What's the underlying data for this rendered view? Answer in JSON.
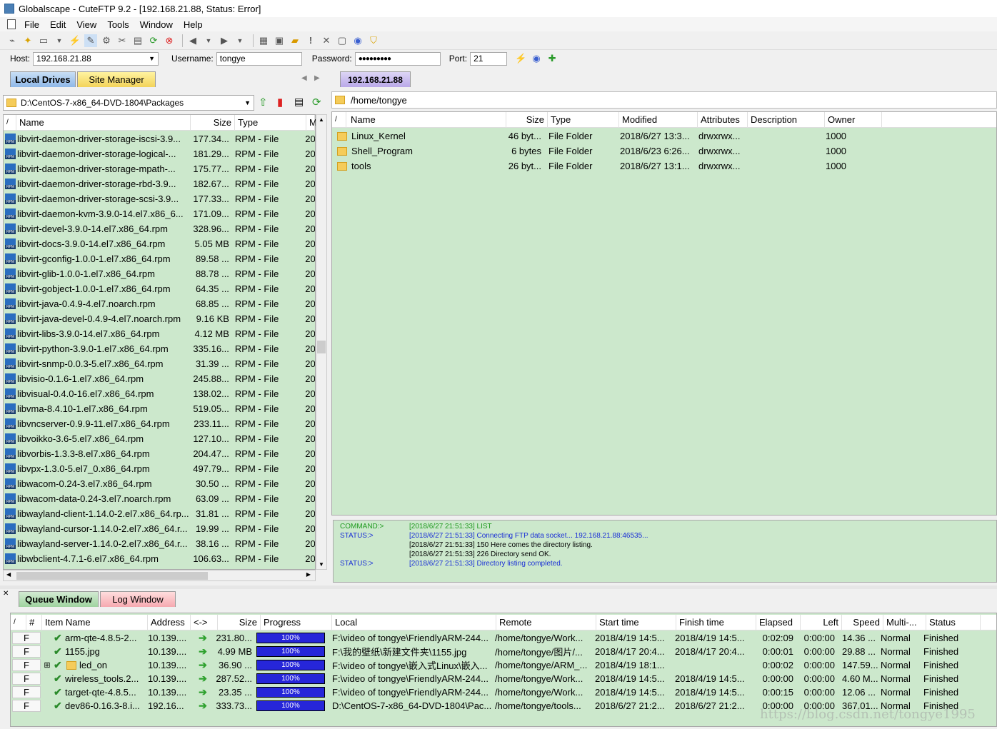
{
  "window": {
    "title": "Globalscape - CuteFTP 9.2 - [192.168.21.88, Status: Error]"
  },
  "menu": [
    "File",
    "Edit",
    "View",
    "Tools",
    "Window",
    "Help"
  ],
  "connection": {
    "host_label": "Host:",
    "host_value": "192.168.21.88",
    "username_label": "Username:",
    "username_value": "tongye",
    "password_label": "Password:",
    "password_value": "●●●●●●●●●",
    "port_label": "Port:",
    "port_value": "21"
  },
  "left_tabs": {
    "local": "Local Drives",
    "site": "Site Manager"
  },
  "left_path": "D:\\CentOS-7-x86_64-DVD-1804\\Packages",
  "left_columns": [
    "/",
    "Name",
    "Size",
    "Type",
    "M"
  ],
  "left_files": [
    {
      "name": "libvirt-daemon-driver-storage-iscsi-3.9...",
      "size": "177.34...",
      "type": "RPM - File",
      "m": "20"
    },
    {
      "name": "libvirt-daemon-driver-storage-logical-...",
      "size": "181.29...",
      "type": "RPM - File",
      "m": "20"
    },
    {
      "name": "libvirt-daemon-driver-storage-mpath-...",
      "size": "175.77...",
      "type": "RPM - File",
      "m": "20"
    },
    {
      "name": "libvirt-daemon-driver-storage-rbd-3.9...",
      "size": "182.67...",
      "type": "RPM - File",
      "m": "20"
    },
    {
      "name": "libvirt-daemon-driver-storage-scsi-3.9...",
      "size": "177.33...",
      "type": "RPM - File",
      "m": "20"
    },
    {
      "name": "libvirt-daemon-kvm-3.9.0-14.el7.x86_6...",
      "size": "171.09...",
      "type": "RPM - File",
      "m": "20"
    },
    {
      "name": "libvirt-devel-3.9.0-14.el7.x86_64.rpm",
      "size": "328.96...",
      "type": "RPM - File",
      "m": "20"
    },
    {
      "name": "libvirt-docs-3.9.0-14.el7.x86_64.rpm",
      "size": "5.05 MB",
      "type": "RPM - File",
      "m": "20"
    },
    {
      "name": "libvirt-gconfig-1.0.0-1.el7.x86_64.rpm",
      "size": "89.58 ...",
      "type": "RPM - File",
      "m": "20"
    },
    {
      "name": "libvirt-glib-1.0.0-1.el7.x86_64.rpm",
      "size": "88.78 ...",
      "type": "RPM - File",
      "m": "20"
    },
    {
      "name": "libvirt-gobject-1.0.0-1.el7.x86_64.rpm",
      "size": "64.35 ...",
      "type": "RPM - File",
      "m": "20"
    },
    {
      "name": "libvirt-java-0.4.9-4.el7.noarch.rpm",
      "size": "68.85 ...",
      "type": "RPM - File",
      "m": "20"
    },
    {
      "name": "libvirt-java-devel-0.4.9-4.el7.noarch.rpm",
      "size": "9.16 KB",
      "type": "RPM - File",
      "m": "20"
    },
    {
      "name": "libvirt-libs-3.9.0-14.el7.x86_64.rpm",
      "size": "4.12 MB",
      "type": "RPM - File",
      "m": "20"
    },
    {
      "name": "libvirt-python-3.9.0-1.el7.x86_64.rpm",
      "size": "335.16...",
      "type": "RPM - File",
      "m": "20"
    },
    {
      "name": "libvirt-snmp-0.0.3-5.el7.x86_64.rpm",
      "size": "31.39 ...",
      "type": "RPM - File",
      "m": "20"
    },
    {
      "name": "libvisio-0.1.6-1.el7.x86_64.rpm",
      "size": "245.88...",
      "type": "RPM - File",
      "m": "20"
    },
    {
      "name": "libvisual-0.4.0-16.el7.x86_64.rpm",
      "size": "138.02...",
      "type": "RPM - File",
      "m": "20"
    },
    {
      "name": "libvma-8.4.10-1.el7.x86_64.rpm",
      "size": "519.05...",
      "type": "RPM - File",
      "m": "20"
    },
    {
      "name": "libvncserver-0.9.9-11.el7.x86_64.rpm",
      "size": "233.11...",
      "type": "RPM - File",
      "m": "20"
    },
    {
      "name": "libvoikko-3.6-5.el7.x86_64.rpm",
      "size": "127.10...",
      "type": "RPM - File",
      "m": "20"
    },
    {
      "name": "libvorbis-1.3.3-8.el7.x86_64.rpm",
      "size": "204.47...",
      "type": "RPM - File",
      "m": "20"
    },
    {
      "name": "libvpx-1.3.0-5.el7_0.x86_64.rpm",
      "size": "497.79...",
      "type": "RPM - File",
      "m": "20"
    },
    {
      "name": "libwacom-0.24-3.el7.x86_64.rpm",
      "size": "30.50 ...",
      "type": "RPM - File",
      "m": "20"
    },
    {
      "name": "libwacom-data-0.24-3.el7.noarch.rpm",
      "size": "63.09 ...",
      "type": "RPM - File",
      "m": "20"
    },
    {
      "name": "libwayland-client-1.14.0-2.el7.x86_64.rp...",
      "size": "31.81 ...",
      "type": "RPM - File",
      "m": "20"
    },
    {
      "name": "libwayland-cursor-1.14.0-2.el7.x86_64.r...",
      "size": "19.99 ...",
      "type": "RPM - File",
      "m": "20"
    },
    {
      "name": "libwayland-server-1.14.0-2.el7.x86_64.r...",
      "size": "38.16 ...",
      "type": "RPM - File",
      "m": "20"
    },
    {
      "name": "libwbclient-4.7.1-6.el7.x86_64.rpm",
      "size": "106.63...",
      "type": "RPM - File",
      "m": "20"
    }
  ],
  "remote_tab": "192.168.21.88",
  "remote_path": "/home/tongye",
  "remote_columns": [
    "/",
    "Name",
    "Size",
    "Type",
    "Modified",
    "Attributes",
    "Description",
    "Owner"
  ],
  "remote_files": [
    {
      "name": "Linux_Kernel",
      "size": "46 byt...",
      "type": "File Folder",
      "modified": "2018/6/27 13:3...",
      "attributes": "drwxrwx...",
      "description": "",
      "owner": "1000"
    },
    {
      "name": "Shell_Program",
      "size": "6 bytes",
      "type": "File Folder",
      "modified": "2018/6/23 6:26...",
      "attributes": "drwxrwx...",
      "description": "",
      "owner": "1000"
    },
    {
      "name": "tools",
      "size": "26 byt...",
      "type": "File Folder",
      "modified": "2018/6/27 13:1...",
      "attributes": "drwxrwx...",
      "description": "",
      "owner": "1000"
    }
  ],
  "log_lines": [
    {
      "label": "COMMAND:>",
      "text": "[2018/6/27 21:51:33] LIST",
      "color": "#1f9a1f"
    },
    {
      "label": "STATUS:>",
      "text": "[2018/6/27 21:51:33] Connecting FTP data socket... 192.168.21.88:46535...",
      "color": "#1a2fd6"
    },
    {
      "label": "",
      "text": "[2018/6/27 21:51:33] 150 Here comes the directory listing.",
      "color": "#000000"
    },
    {
      "label": "",
      "text": "[2018/6/27 21:51:33] 226 Directory send OK.",
      "color": "#000000"
    },
    {
      "label": "STATUS:>",
      "text": "[2018/6/27 21:51:33] Directory listing completed.",
      "color": "#1a2fd6"
    }
  ],
  "queue_tabs": {
    "queue": "Queue Window",
    "log": "Log Window"
  },
  "queue_columns": [
    "/",
    "#",
    "Item Name",
    "Address",
    "<->",
    "Size",
    "Progress",
    "Local",
    "Remote",
    "Start time",
    "Finish time",
    "Elapsed",
    "Left",
    "Speed",
    "Multi-...",
    "Status"
  ],
  "queue_items": [
    {
      "flag": "F",
      "name": "arm-qte-4.8.5-2...",
      "address": "10.139....",
      "size": "231.80...",
      "progress": "100%",
      "local": "F:\\video of tongye\\FriendlyARM-244...",
      "remote": "/home/tongye/Work...",
      "start": "2018/4/19 14:5...",
      "finish": "2018/4/19 14:5...",
      "elapsed": "0:02:09",
      "left": "0:00:00",
      "speed": "14.36 ...",
      "multi": "Normal",
      "status": "Finished",
      "folder": false
    },
    {
      "flag": "F",
      "name": "1155.jpg",
      "address": "10.139....",
      "size": "4.99 MB",
      "progress": "100%",
      "local": "F:\\我的壁纸\\新建文件夹\\1155.jpg",
      "remote": "/home/tongye/图片/...",
      "start": "2018/4/17 20:4...",
      "finish": "2018/4/17 20:4...",
      "elapsed": "0:00:01",
      "left": "0:00:00",
      "speed": "29.88 ...",
      "multi": "Normal",
      "status": "Finished",
      "folder": false
    },
    {
      "flag": "F",
      "name": "led_on",
      "address": "10.139....",
      "size": "36.90 ...",
      "progress": "100%",
      "local": "F:\\video of tongye\\嵌入式Linux\\嵌入...",
      "remote": "/home/tongye/ARM_...",
      "start": "2018/4/19 18:1...",
      "finish": "",
      "elapsed": "0:00:02",
      "left": "0:00:00",
      "speed": "147.59...",
      "multi": "Normal",
      "status": "Finished",
      "folder": true
    },
    {
      "flag": "F",
      "name": "wireless_tools.2...",
      "address": "10.139....",
      "size": "287.52...",
      "progress": "100%",
      "local": "F:\\video of tongye\\FriendlyARM-244...",
      "remote": "/home/tongye/Work...",
      "start": "2018/4/19 14:5...",
      "finish": "2018/4/19 14:5...",
      "elapsed": "0:00:00",
      "left": "0:00:00",
      "speed": "4.60 M...",
      "multi": "Normal",
      "status": "Finished",
      "folder": false
    },
    {
      "flag": "F",
      "name": "target-qte-4.8.5...",
      "address": "10.139....",
      "size": "23.35 ...",
      "progress": "100%",
      "local": "F:\\video of tongye\\FriendlyARM-244...",
      "remote": "/home/tongye/Work...",
      "start": "2018/4/19 14:5...",
      "finish": "2018/4/19 14:5...",
      "elapsed": "0:00:15",
      "left": "0:00:00",
      "speed": "12.06 ...",
      "multi": "Normal",
      "status": "Finished",
      "folder": false
    },
    {
      "flag": "F",
      "name": "dev86-0.16.3-8.i...",
      "address": "192.16...",
      "size": "333.73...",
      "progress": "100%",
      "local": "D:\\CentOS-7-x86_64-DVD-1804\\Pac...",
      "remote": "/home/tongye/tools...",
      "start": "2018/6/27 21:2...",
      "finish": "2018/6/27 21:2...",
      "elapsed": "0:00:00",
      "left": "0:00:00",
      "speed": "367.01...",
      "multi": "Normal",
      "status": "Finished",
      "folder": false
    }
  ],
  "watermark": "https://blog.csdn.net/tongye1995"
}
